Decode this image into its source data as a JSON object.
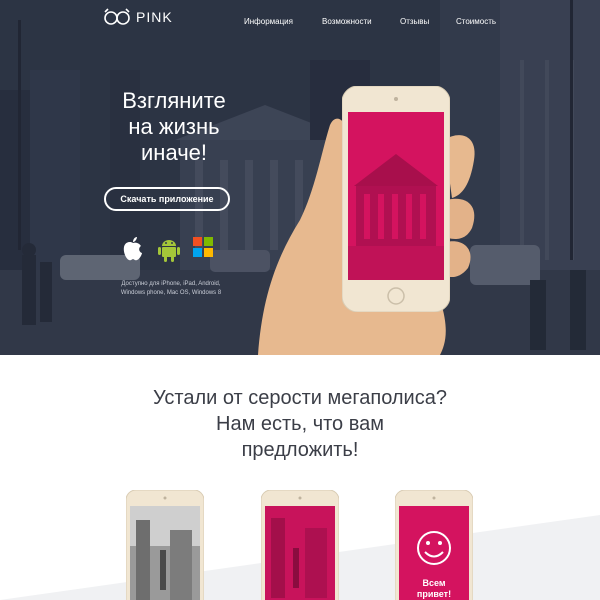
{
  "brand": {
    "logo_text": "PINK"
  },
  "nav": {
    "items": [
      {
        "label": "Информация"
      },
      {
        "label": "Возможности"
      },
      {
        "label": "Отзывы"
      },
      {
        "label": "Стоимость"
      }
    ]
  },
  "hero": {
    "title_lines": [
      "Взгляните",
      "на жизнь",
      "иначе!"
    ],
    "download_label": "Скачать приложение",
    "platforms_lines": [
      "Доступно для iPhone, iPad, Android,",
      "Windows phone, Mac OS, Windows 8"
    ],
    "os_icons": [
      "apple-icon",
      "android-icon",
      "windows-icon"
    ]
  },
  "section2": {
    "tagline_lines": [
      "Устали от серости мегаполиса?",
      "Нам есть, что вам",
      "предложить!"
    ],
    "phones": [
      {
        "screen": "greyscale-photo"
      },
      {
        "screen": "pink-photo"
      },
      {
        "screen": "pink-smiley",
        "caption_lines": [
          "Всем",
          "привет!"
        ]
      }
    ]
  },
  "colors": {
    "accent_pink": "#d4135f",
    "hero_dark": "#2c3446",
    "text_dark": "#3b3e47",
    "phone_gold": "#f1e6d2"
  }
}
